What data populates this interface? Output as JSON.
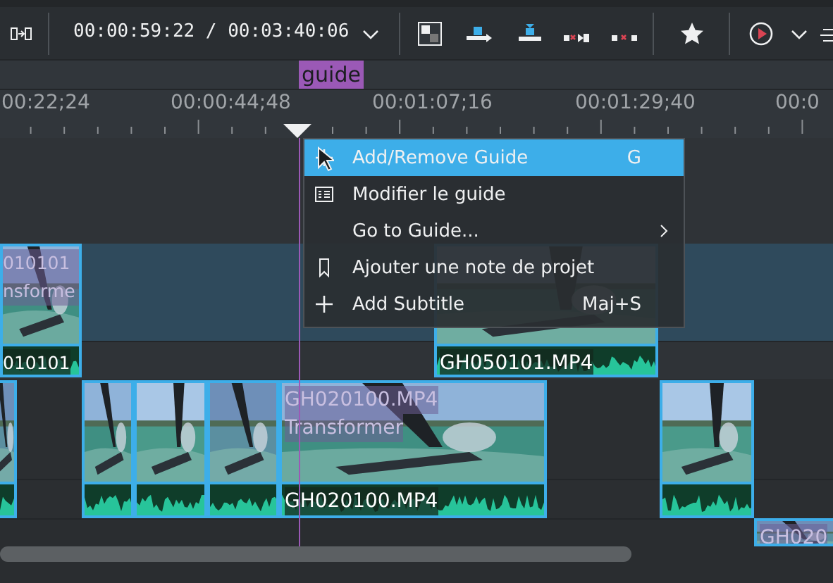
{
  "toolbar": {
    "timecode": "00:00:59:22 / 00:03:40:06"
  },
  "guide": {
    "label": "guide"
  },
  "ruler": {
    "labels": [
      "00:22;24",
      "00:00:44;48",
      "00:01:07;16",
      "00:01:29;40",
      "00:0"
    ]
  },
  "clips": [
    {
      "title": "010101",
      "effect": "nsforme",
      "audio_title": "010101"
    },
    {
      "audio_title": "GH050101.MP4"
    },
    {
      "title": "GH020100.MP4",
      "effect": "Transformer",
      "audio_title": "GH020100.MP4"
    },
    {
      "title": "GH020"
    }
  ],
  "context_menu": [
    {
      "label": "Add/Remove Guide",
      "shortcut": "G",
      "selected": true,
      "submenu": false
    },
    {
      "label": "Modifier le guide",
      "selected": false,
      "submenu": false
    },
    {
      "label": "Go to Guide...",
      "selected": false,
      "submenu": true
    },
    {
      "label": "Ajouter une note de projet",
      "selected": false,
      "submenu": false
    },
    {
      "label": "Add Subtitle",
      "shortcut": "Maj+S",
      "selected": false,
      "submenu": false
    }
  ]
}
